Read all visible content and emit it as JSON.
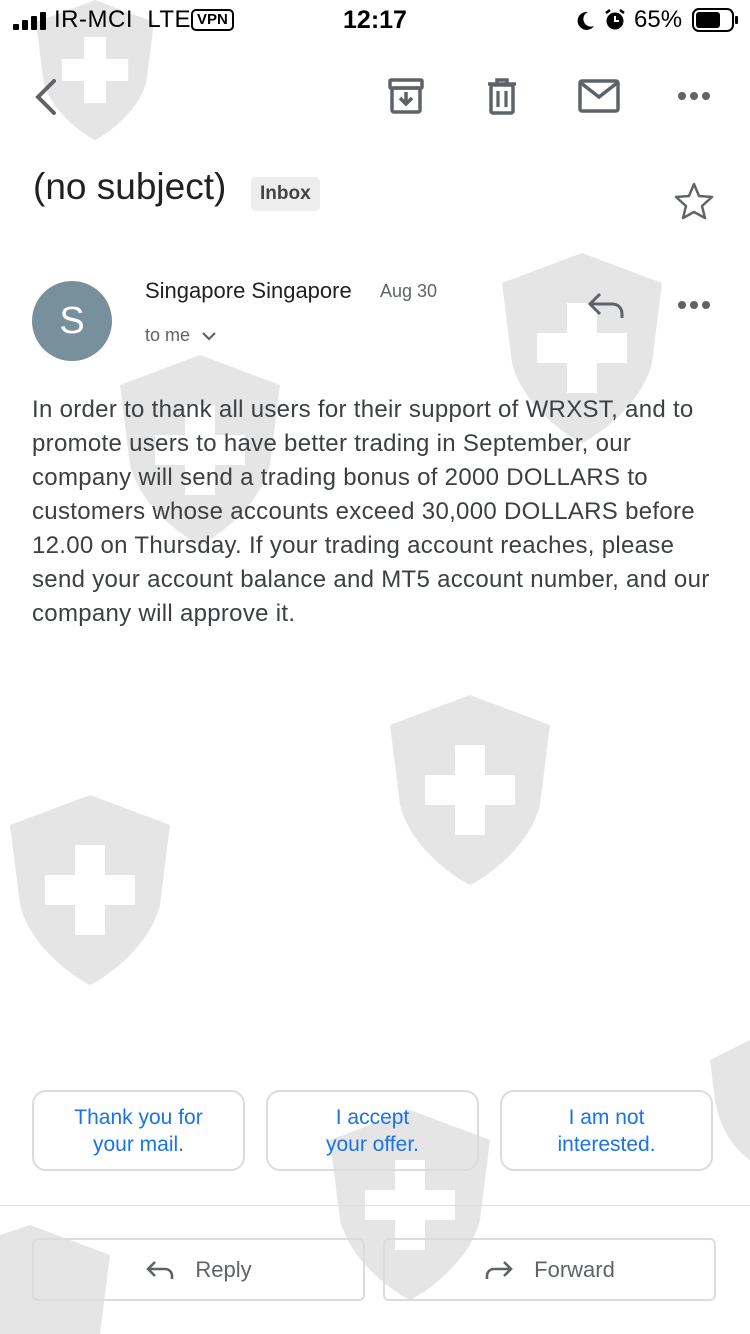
{
  "status_bar": {
    "carrier": "IR-MCI",
    "network": "LTE",
    "vpn": "VPN",
    "time": "12:17",
    "battery": "65%",
    "icons": [
      "signal-icon",
      "moon-icon",
      "alarm-icon",
      "battery-icon"
    ]
  },
  "toolbar": {
    "icons": [
      "back-arrow-icon",
      "archive-icon",
      "trash-icon",
      "mail-icon",
      "more-icon"
    ]
  },
  "email": {
    "subject": "(no subject)",
    "label": "Inbox",
    "sender": "Singapore Singapore",
    "avatar_letter": "S",
    "date": "Aug 30",
    "to": "to me",
    "body": "In order to thank all users for their support of WRXST, and to promote users to have better trading in September, our company will send a trading bonus of 2000 DOLLARS to customers whose accounts exceed 30,000 DOLLARS before 12.00 on Thursday. If your trading account reaches, please send your account balance and MT5 account number, and our company will approve it."
  },
  "smart_replies": [
    {
      "line1": "Thank you for",
      "line2": "your mail."
    },
    {
      "line1": "I accept",
      "line2": "your offer."
    },
    {
      "line1": "I am not",
      "line2": "interested."
    }
  ],
  "actions": {
    "reply": "Reply",
    "forward": "Forward"
  },
  "colors": {
    "accent": "#1a73e8",
    "avatar": "#78909c",
    "chip_bg": "#ededed",
    "border": "#dadce0"
  }
}
